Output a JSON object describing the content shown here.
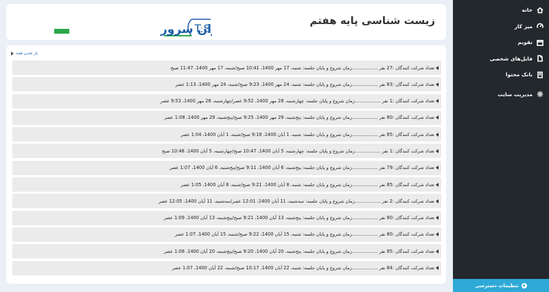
{
  "page": {
    "title": "زیست شناسی پایه هفتم"
  },
  "logo": {
    "brand_text": "T.S",
    "site_text": "تهران‌ سرور"
  },
  "sidebar": {
    "items": [
      {
        "label": "خانه",
        "icon": "home-icon"
      },
      {
        "label": "میز کار",
        "icon": "dashboard-icon"
      },
      {
        "label": "تقویم",
        "icon": "calendar-icon"
      },
      {
        "label": "فایل‌های شخصی",
        "icon": "file-icon"
      },
      {
        "label": "بانک محتوا",
        "icon": "bank-icon"
      },
      {
        "label": "مدیریت سایت",
        "icon": "gear-icon"
      }
    ],
    "accessibility_label": "تنظیمات دسترسی"
  },
  "content": {
    "expand_all": "باز شدن همه",
    "sessions": [
      "تعداد شرکت کنندگان :27 نفر ..................زمان شروع و پایان جلسه: شنبه، 17 مهر 1400، 10:41 صبح/شنبه، 17 مهر 1400، 11:47 صبح",
      "تعداد شرکت کنندگان :83 نفر ..................زمان شروع و پایان جلسه: شنبه، 24 مهر 1400، 9:23 صبح/شنبه، 24 مهر 1400، 1:13 عصر",
      "تعداد شرکت کنندگان :1 نفر ..................زمان شروع و پایان جلسه: چهارشنبه، 28 مهر 1400، 9:52 عصر/چهارشنبه، 28 مهر 1400، 9:53 عصر",
      "تعداد شرکت کنندگان :80 نفر ..................زمان شروع و پایان جلسه: پنج‌شنبه، 29 مهر 1400، 9:25 صبح/پنج‌شنبه، 29 مهر 1400، 1:08 عصر",
      "تعداد شرکت کنندگان :85 نفر ..................زمان شروع و پایان جلسه: شنبه، 1 آبان 1400، 9:18 صبح/شنبه، 1 آبان 1400، 1:04 عصر",
      "تعداد شرکت کنندگان :1 نفر ..................زمان شروع و پایان جلسه: چهارشنبه، 5 آبان 1400، 10:47 صبح/چهارشنبه، 5 آبان 1400، 10:48 صبح",
      "تعداد شرکت کنندگان :79 نفر ..................زمان شروع و پایان جلسه: پنج‌شنبه، 6 آبان 1400، 9:11 صبح/پنج‌شنبه، 6 آبان 1400، 1:07 عصر",
      "تعداد شرکت کنندگان :85 نفر ..................زمان شروع و پایان جلسه: شنبه، 8 آبان 1400، 9:21 صبح/شنبه، 8 آبان 1400، 1:05 عصر",
      "تعداد شرکت کنندگان :2 نفر ..................زمان شروع و پایان جلسه: سه‌شنبه، 11 آبان 1400، 12:01 عصر/سه‌شنبه، 11 آبان 1400، 12:05 عصر",
      "تعداد شرکت کنندگان :80 نفر ..................زمان شروع و پایان جلسه: پنج‌شنبه، 13 آبان 1400، 9:21 صبح/پنج‌شنبه، 13 آبان 1400، 1:09 عصر",
      "تعداد شرکت کنندگان :80 نفر ..................زمان شروع و پایان جلسه: شنبه، 15 آبان 1400، 9:22 صبح/شنبه، 15 آبان 1400، 1:07 عصر",
      "تعداد شرکت کنندگان :85 نفر ..................زمان شروع و پایان جلسه: پنج‌شنبه، 20 آبان 1400، 9:20 صبح/پنج‌شنبه، 20 آبان 1400، 1:08 عصر",
      "تعداد شرکت کنندگان :84 نفر ..................زمان شروع و پایان جلسه: شنبه، 22 آبان 1400، 10:17 صبح/شنبه، 22 آبان 1400، 1:07 عصر"
    ]
  },
  "colors": {
    "sidebar_bg": "#23282d",
    "accent": "#2ea9d8",
    "logo_blue": "#1e5fa8",
    "logo_green": "#2aa84a",
    "link": "#2a6fb8"
  }
}
